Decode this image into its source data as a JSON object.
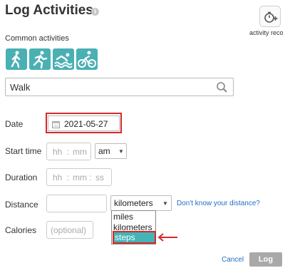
{
  "header": {
    "title": "Log Activities",
    "info_glyph": "i"
  },
  "activity_reco": {
    "label": "activity reco",
    "icon": "stopwatch-plus-icon"
  },
  "common": {
    "label": "Common activities",
    "accent_color": "#4ab0b4",
    "items": [
      {
        "icon": "walking-icon"
      },
      {
        "icon": "running-icon"
      },
      {
        "icon": "swimming-icon"
      },
      {
        "icon": "cycling-icon"
      }
    ]
  },
  "search": {
    "value": "Walk",
    "icon": "search-icon"
  },
  "form": {
    "date_label": "Date",
    "date_value": "2021-05-27",
    "start_time_label": "Start time",
    "hh": "hh",
    "mm": "mm",
    "ss": "ss",
    "sep": ":",
    "ampm_value": "am",
    "duration_label": "Duration",
    "distance_label": "Distance",
    "unit_selected": "kilometers",
    "unit_options": [
      "miles",
      "kilometers",
      "steps"
    ],
    "highlighted_option": "steps",
    "distance_help_link": "Don't know your distance?",
    "calories_label": "Calories",
    "calories_placeholder": "(optional)"
  },
  "footer": {
    "cancel_label": "Cancel",
    "log_label": "Log"
  },
  "annotation_color": "#d42a2a"
}
